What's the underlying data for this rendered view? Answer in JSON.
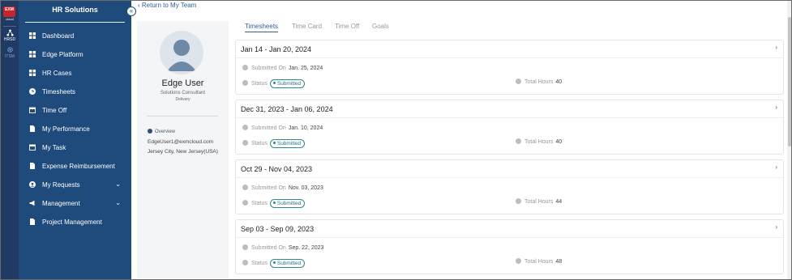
{
  "rail": {
    "logo_text": "EXM",
    "logo_sub": "cloud",
    "items": [
      {
        "label": "HRSD",
        "icon": "org-icon"
      },
      {
        "label": "ITSM",
        "icon": "gear-icon"
      }
    ]
  },
  "sidebar": {
    "title": "HR Solutions",
    "collapse_glyph": "«",
    "items": [
      {
        "label": "Dashboard",
        "icon": "grid-icon"
      },
      {
        "label": "Edge Platform",
        "icon": "grid-icon"
      },
      {
        "label": "HR Cases",
        "icon": "grid-icon"
      },
      {
        "label": "Timesheets",
        "icon": "clock-icon"
      },
      {
        "label": "Time Off",
        "icon": "calendar-icon"
      },
      {
        "label": "My Performance",
        "icon": "document-icon"
      },
      {
        "label": "My Task",
        "icon": "calendar-icon"
      },
      {
        "label": "Expense Reimbursement",
        "icon": "document-icon"
      },
      {
        "label": "My Requests",
        "icon": "user-icon",
        "expandable": true
      },
      {
        "label": "Management",
        "icon": "megaphone-icon",
        "expandable": true
      },
      {
        "label": "Project Management",
        "icon": "document-icon"
      }
    ]
  },
  "back_link": "Return to My Team",
  "profile": {
    "name": "Edge User",
    "role": "Solutions Consultant",
    "department": "Delivery",
    "overview_label": "Overview",
    "email": "EdgeUser1@exmcloud.com",
    "location": "Jersey City, New Jersey(USA)"
  },
  "tabs": [
    "Timesheets",
    "Time Card",
    "Time Off",
    "Goals"
  ],
  "active_tab": "Timesheets",
  "labels": {
    "submitted_on": "Submitted On",
    "status": "Status",
    "total_hours": "Total Hours"
  },
  "timesheets": [
    {
      "range": "Jan 14 - Jan 20, 2024",
      "submitted_on": "Jan. 25, 2024",
      "status": "Submitted",
      "total_hours": "40"
    },
    {
      "range": "Dec 31, 2023 - Jan 06, 2024",
      "submitted_on": "Jan. 10, 2024",
      "status": "Submitted",
      "total_hours": "40"
    },
    {
      "range": "Oct 29 - Nov 04, 2023",
      "submitted_on": "Nov. 03, 2023",
      "status": "Submitted",
      "total_hours": "44"
    },
    {
      "range": "Sep 03 - Sep 09, 2023",
      "submitted_on": "Sep. 22, 2023",
      "status": "Submitted",
      "total_hours": "48"
    }
  ],
  "colors": {
    "sidebar_bg": "#1e4a7c",
    "rail_bg": "#1f3b64",
    "accent": "#2f5f9e",
    "status_badge": "#2e8b8b"
  }
}
